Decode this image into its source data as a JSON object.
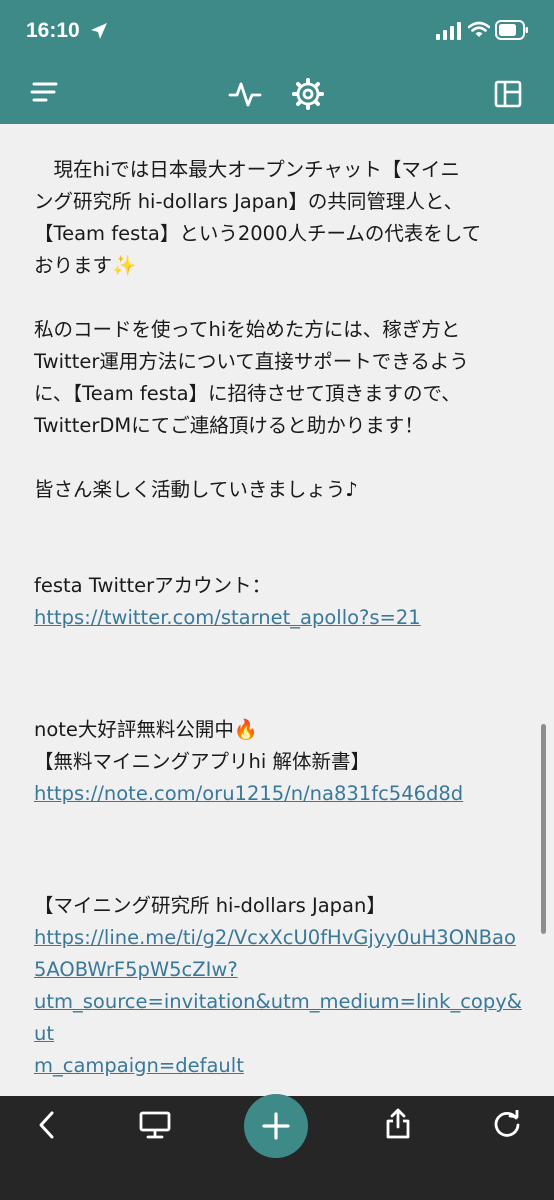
{
  "status_bar": {
    "time": "16:10"
  },
  "toolbar": {
    "menu_icon": "menu-lines-icon",
    "activity_icon": "pulse-icon",
    "settings_icon": "gear-icon",
    "layout_icon": "panel-layout-icon"
  },
  "content": {
    "paragraph1_lines": [
      "　現在hiでは日本最大オープンチャット【マイニ",
      "ング研究所 hi-dollars Japan】の共同管理人と、",
      "【Team festa】という2000人チームの代表をして",
      "おります✨"
    ],
    "paragraph2_lines": [
      "私のコードを使ってhiを始めた方には、稼ぎ方と",
      "Twitter運用方法について直接サポートできるよう",
      "に、【Team festa】に招待させて頂きますので、",
      "TwitterDMにてご連絡頂けると助かります！"
    ],
    "paragraph3": "皆さん楽しく活動していきましょう♪",
    "twitter_label": "festa Twitterアカウント：",
    "twitter_link": "https://twitter.com/starnet_apollo?s=21",
    "note_line1": "note大好評無料公開中🔥",
    "note_line2": "【無料マイニングアプリhi 解体新書】",
    "note_link": "https://note.com/oru1215/n/na831fc546d8d",
    "line_label": "【マイニング研究所 hi-dollars Japan】",
    "line_link_lines": [
      "https://line.me/ti/g2/VcxXcU0fHvGjyy0uH3ONBao",
      "5AOBWrF5pW5cZIw?",
      "utm_source=invitation&utm_medium=link_copy&ut",
      "m_campaign=default"
    ]
  },
  "bottom_bar": {
    "back_icon": "chevron-left-icon",
    "desktop_icon": "desktop-icon",
    "add_icon": "plus-icon",
    "share_icon": "share-icon",
    "reload_icon": "reload-icon"
  },
  "colors": {
    "header": "#3d8a88",
    "bottom_bar": "#262626",
    "link": "#3a7898",
    "background": "#f0f0f0"
  }
}
